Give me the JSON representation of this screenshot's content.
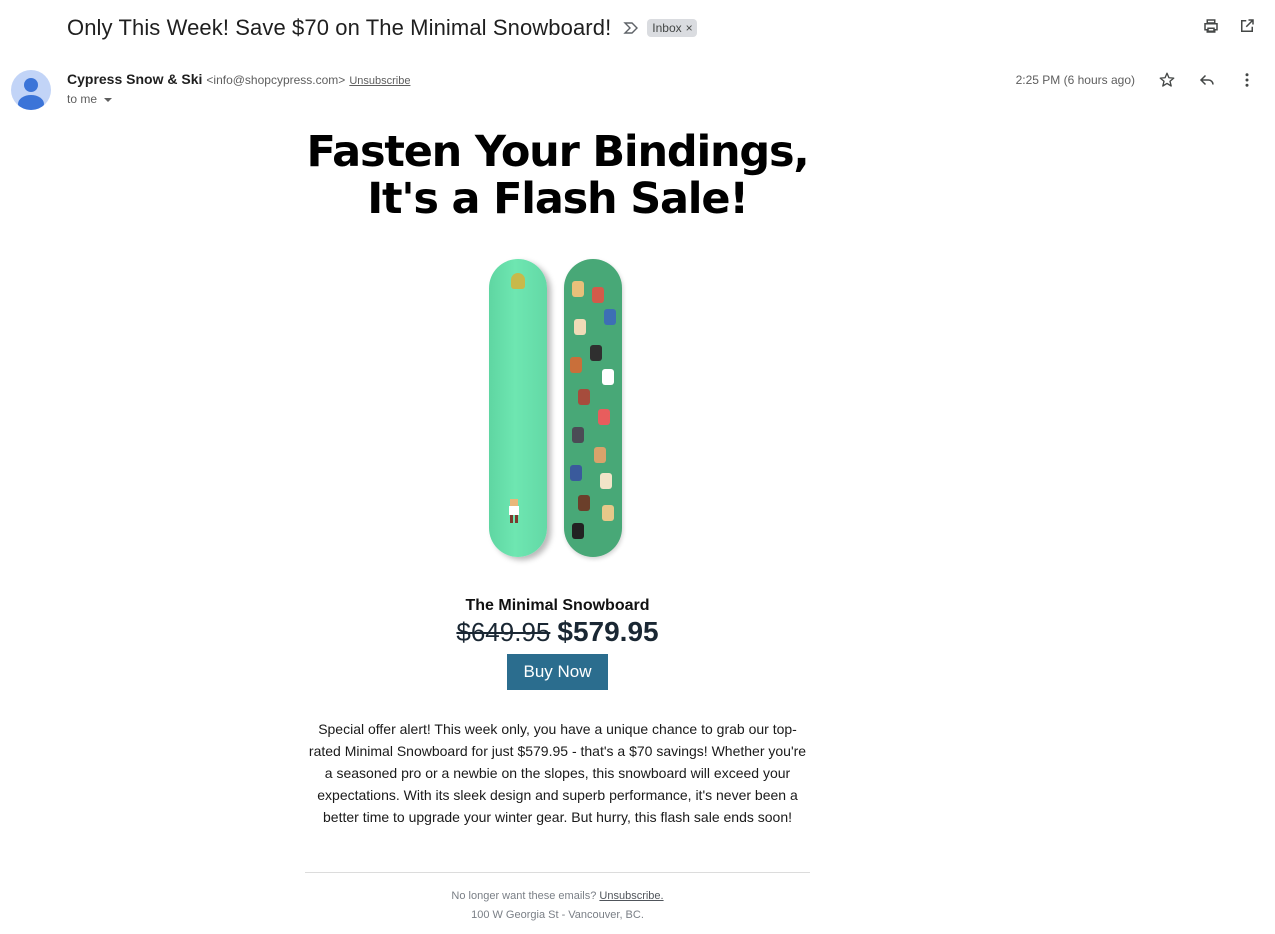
{
  "header": {
    "subject": "Only This Week! Save $70 on The Minimal Snowboard!",
    "label": "Inbox",
    "label_close": "×",
    "icons": [
      "print-icon",
      "open-in-new-window-icon"
    ]
  },
  "message": {
    "sender_name": "Cypress Snow & Ski",
    "sender_email": "<info@shopcypress.com>",
    "unsubscribe": "Unsubscribe",
    "recipient": "to me",
    "date": "2:25 PM (6 hours ago)",
    "actions": [
      "star-icon",
      "reply-icon",
      "more-vertical-icon"
    ]
  },
  "body": {
    "headline_line1": "Fasten Your Bindings,",
    "headline_line2": "It's a Flash Sale!",
    "product_name": "The Minimal Snowboard",
    "old_price": "$649.95",
    "new_price": "$579.95",
    "buy_button": "Buy Now",
    "description": "Special offer alert! This week only, you have a unique chance to grab our top-rated Minimal Snowboard for just $579.95 - that's a $70 savings! Whether you're a seasoned pro or a newbie on the slopes, this snowboard will exceed your expectations. With its sleek design and superb performance, it's never been a better time to upgrade your winter gear. But hurry, this flash sale ends soon!"
  },
  "footer": {
    "no_longer": "No longer want these emails?",
    "unsubscribe": "Unsubscribe.",
    "address": "100 W Georgia St - Vancouver, BC."
  },
  "colors": {
    "board_mint": "#6ee6b1",
    "board_green": "#48a877",
    "button_blue": "#2b6d8e",
    "price_navy": "#1a2733"
  }
}
